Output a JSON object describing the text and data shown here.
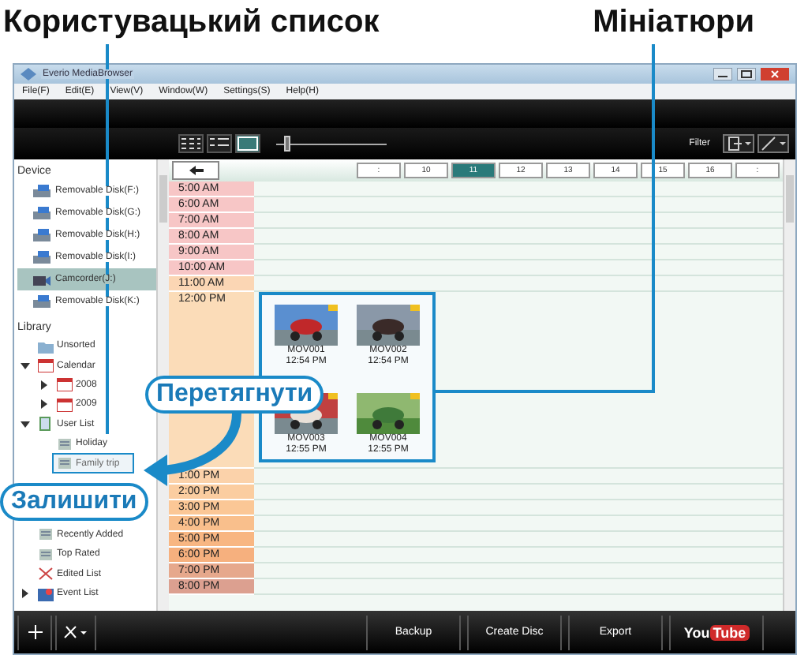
{
  "callout_titles": [
    "Користувацький список",
    "Мініатюри"
  ],
  "window": {
    "title": "Everio MediaBrowser"
  },
  "menu": [
    "File(F)",
    "Edit(E)",
    "View(V)",
    "Window(W)",
    "Settings(S)",
    "Help(H)"
  ],
  "toolbar": {
    "views": [
      {
        "kind": "grid",
        "selected": false
      },
      {
        "kind": "list",
        "selected": false
      },
      {
        "kind": "calendar",
        "selected": true
      }
    ],
    "zoom": {
      "level": 0.1
    },
    "filter_label": "Filter"
  },
  "sidebar": {
    "device_heading": "Device",
    "devices": [
      {
        "label": "Removable Disk(F:)",
        "kind": "disk",
        "selected": false
      },
      {
        "label": "Removable Disk(G:)",
        "kind": "disk",
        "selected": false
      },
      {
        "label": "Removable Disk(H:)",
        "kind": "disk",
        "selected": false
      },
      {
        "label": "Removable Disk(I:)",
        "kind": "disk",
        "selected": false
      },
      {
        "label": "Camcorder(J:)",
        "kind": "camera",
        "selected": true
      },
      {
        "label": "Removable Disk(K:)",
        "kind": "disk",
        "selected": false
      }
    ],
    "library_heading": "Library",
    "library": [
      {
        "label": "Unsorted",
        "kind": "folder",
        "selected": false
      },
      {
        "label": "Calendar",
        "kind": "calendar",
        "expanded": true,
        "selected": false,
        "children": [
          {
            "label": "2008",
            "kind": "calendar",
            "expanded": false,
            "selected": false
          },
          {
            "label": "2009",
            "kind": "calendar",
            "expanded": false,
            "selected": false
          }
        ]
      },
      {
        "label": "User List",
        "kind": "userlist",
        "expanded": true,
        "selected": false,
        "children": [
          {
            "label": "Holiday",
            "kind": "list",
            "selected": false
          },
          {
            "label": "Family trip",
            "kind": "list",
            "selected": true
          }
        ]
      },
      {
        "label": "Recently Added",
        "kind": "list",
        "selected": false
      },
      {
        "label": "Top Rated",
        "kind": "list",
        "selected": false
      },
      {
        "label": "Edited List",
        "kind": "edited",
        "selected": false
      },
      {
        "label": "Event List",
        "kind": "event",
        "expanded": false,
        "selected": false
      }
    ]
  },
  "date_tabs": [
    {
      "label": ":",
      "selected": false
    },
    {
      "label": "10",
      "selected": false
    },
    {
      "label": "11",
      "selected": true
    },
    {
      "label": "12",
      "selected": false
    },
    {
      "label": "13",
      "selected": false
    },
    {
      "label": "14",
      "selected": false
    },
    {
      "label": "15",
      "selected": false
    },
    {
      "label": "16",
      "selected": false
    },
    {
      "label": ":",
      "selected": false
    }
  ],
  "timeline": [
    {
      "time": "5:00 AM",
      "color": "#f7c6c6",
      "tall": false
    },
    {
      "time": "6:00 AM",
      "color": "#f7c6c6",
      "tall": false
    },
    {
      "time": "7:00 AM",
      "color": "#f7c6c6",
      "tall": false
    },
    {
      "time": "8:00 AM",
      "color": "#f7c6c6",
      "tall": false
    },
    {
      "time": "9:00 AM",
      "color": "#f7c6c6",
      "tall": false
    },
    {
      "time": "10:00 AM",
      "color": "#f7c6c6",
      "tall": false
    },
    {
      "time": "11:00 AM",
      "color": "#fbd6b4",
      "tall": false
    },
    {
      "time": "12:00 PM",
      "color": "#fbdcb8",
      "tall": true
    },
    {
      "time": "1:00 PM",
      "color": "#fbd2aa",
      "tall": false
    },
    {
      "time": "2:00 PM",
      "color": "#fbcda0",
      "tall": false
    },
    {
      "time": "3:00 PM",
      "color": "#fbc796",
      "tall": false
    },
    {
      "time": "4:00 PM",
      "color": "#f9bf8c",
      "tall": false
    },
    {
      "time": "5:00 PM",
      "color": "#f8b682",
      "tall": false
    },
    {
      "time": "6:00 PM",
      "color": "#f6b07e",
      "tall": false
    },
    {
      "time": "7:00 PM",
      "color": "#e6a88c",
      "tall": false
    },
    {
      "time": "8:00 PM",
      "color": "#dca090",
      "tall": false
    }
  ],
  "thumbnails": [
    {
      "name": "MOV001",
      "time": "12:54 PM",
      "kind": "picture"
    },
    {
      "name": "MOV002",
      "time": "12:54 PM",
      "kind": "picture"
    },
    {
      "name": "MOV003",
      "time": "12:55 PM",
      "kind": "picture"
    },
    {
      "name": "MOV004",
      "time": "12:55 PM",
      "kind": "picture"
    }
  ],
  "bottom_buttons": [
    {
      "kind": "text",
      "label": "Backup"
    },
    {
      "kind": "text",
      "label": "Create Disc"
    },
    {
      "kind": "text",
      "label": "Export"
    },
    {
      "kind": "logo",
      "label": "You",
      "badge": "Tube"
    }
  ],
  "callouts": [
    "Перетягнути",
    "Залишити"
  ]
}
